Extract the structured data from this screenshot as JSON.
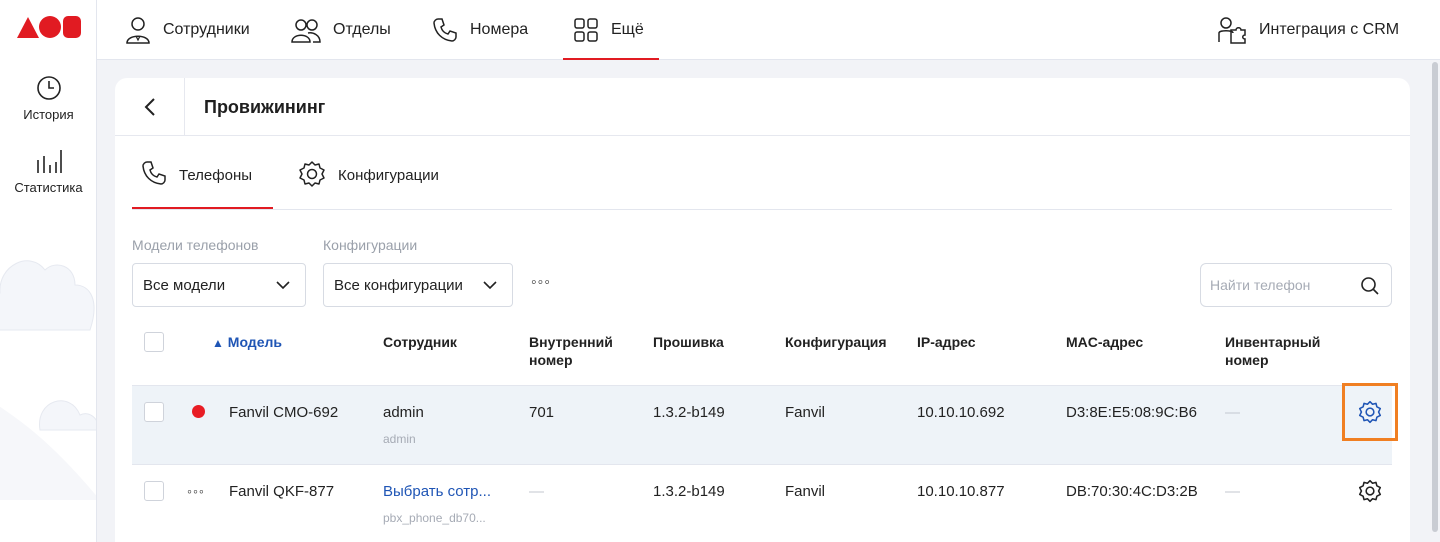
{
  "sidebar": {
    "items": [
      {
        "label": "История"
      },
      {
        "label": "Статистика"
      }
    ]
  },
  "topnav": {
    "items": [
      {
        "label": "Сотрудники"
      },
      {
        "label": "Отделы"
      },
      {
        "label": "Номера"
      },
      {
        "label": "Ещё"
      }
    ],
    "integration_label": "Интеграция с CRM"
  },
  "page": {
    "title": "Провижининг",
    "tabs": [
      {
        "label": "Телефоны"
      },
      {
        "label": "Конфигурации"
      }
    ]
  },
  "filters": {
    "models_label": "Модели телефонов",
    "models_value": "Все модели",
    "configs_label": "Конфигурации",
    "configs_value": "Все конфигурации",
    "more": "◦◦◦",
    "search_placeholder": "Найти телефон"
  },
  "table": {
    "sort_arrow": "▲",
    "columns": {
      "model": "Модель",
      "employee": "Сотрудник",
      "ext": "Внутренний номер",
      "firmware": "Прошивка",
      "config": "Конфигурация",
      "ip": "IP-адрес",
      "mac": "MAC-адрес",
      "inventory": "Инвентарный номер"
    },
    "rows": [
      {
        "model": "Fanvil CMO-692",
        "employee": "admin",
        "employee_sub": "admin",
        "ext": "701",
        "firmware": "1.3.2-b149",
        "config": "Fanvil",
        "ip": "10.10.10.692",
        "mac": "D3:8E:E5:08:9C:B6",
        "inventory": "—"
      },
      {
        "status_more": "◦◦◦",
        "model": "Fanvil QKF-877",
        "employee": "Выбрать сотр...",
        "employee_sub": "pbx_phone_db70...",
        "ext": "—",
        "firmware": "1.3.2-b149",
        "config": "Fanvil",
        "ip": "10.10.10.877",
        "mac": "DB:70:30:4C:D3:2B",
        "inventory": "—"
      }
    ]
  },
  "colors": {
    "brand_red": "#e11b22",
    "link_blue": "#1f55b5",
    "highlight_orange": "#f07f22",
    "row_selected_bg": "#eef3f8"
  }
}
